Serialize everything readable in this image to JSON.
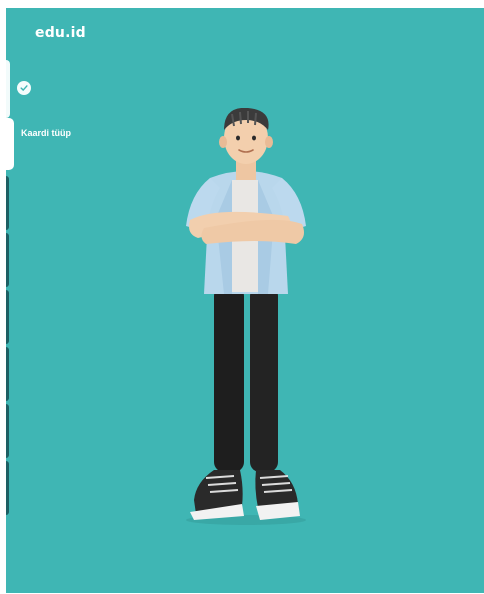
{
  "brand": {
    "logo_text": "edu.id"
  },
  "steps": {
    "completed_icon": "check-icon",
    "active_label": "Kaardi tüüp",
    "pending_count": 6
  },
  "colors": {
    "background": "#3fb6b4",
    "active_tab": "#ffffff",
    "pending_tab": "#1d5f63"
  },
  "illustration": {
    "icon": "3d-man-arms-crossed"
  }
}
